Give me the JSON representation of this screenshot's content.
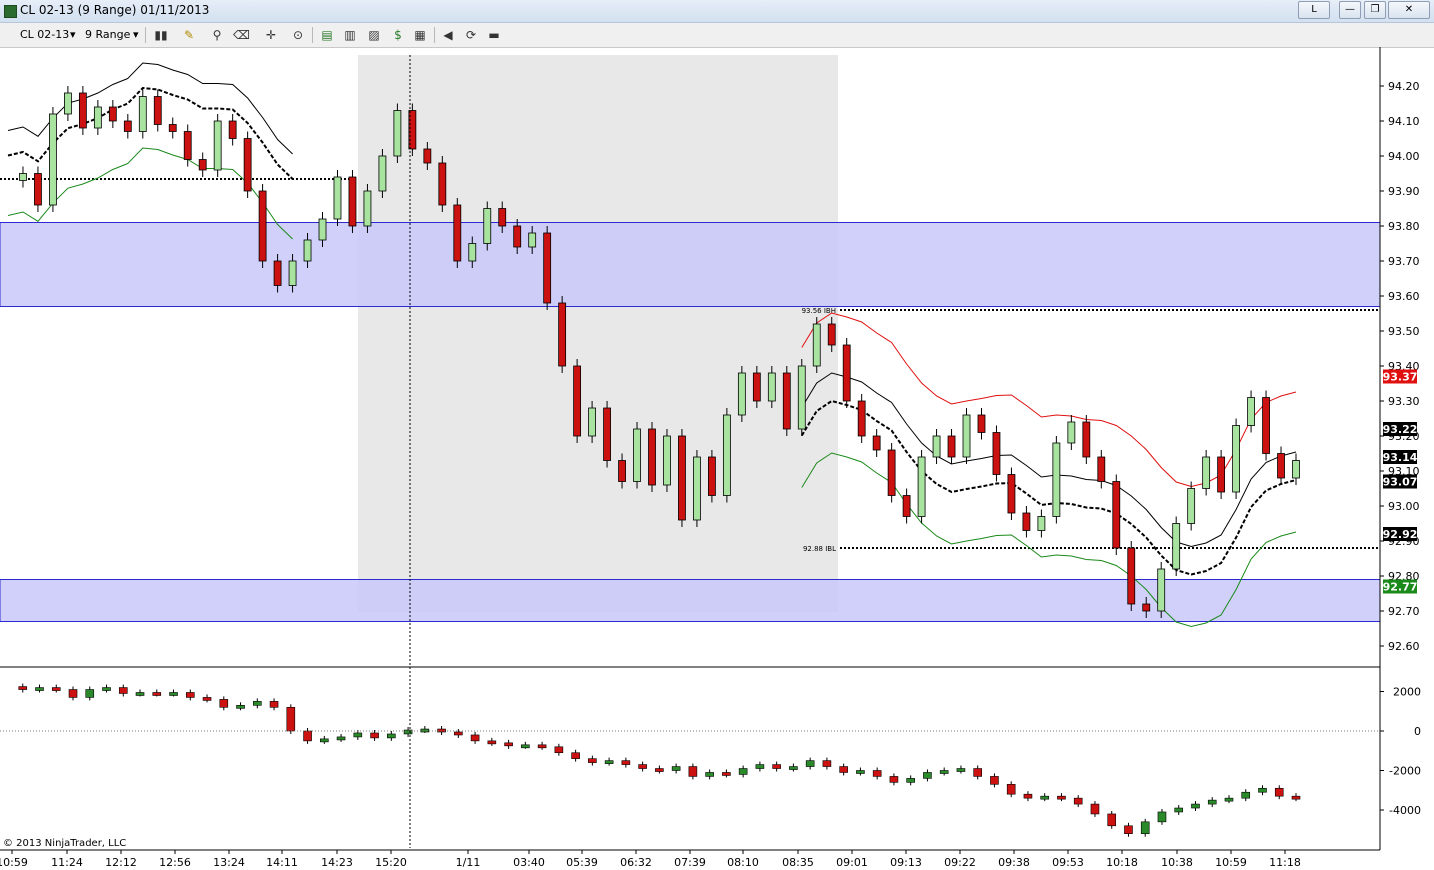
{
  "window": {
    "title": "CL 02-13 (9 Range)  01/11/2013",
    "buttons": {
      "restore": "L",
      "minimize": "—",
      "maximize": "❐",
      "close": "✕"
    }
  },
  "toolbar": {
    "instrument": "CL 02-13",
    "period": "9 Range",
    "icons": [
      "bars-type-icon",
      "draw-pencil-icon",
      "zoom-icon",
      "eraser-icon",
      "crosshair-icon",
      "magnifier-icon",
      "data-box-icon",
      "indicators-icon",
      "strategies-icon",
      "dollar-icon",
      "properties-icon",
      "scroll-back-icon",
      "reload-icon",
      "print-icon"
    ]
  },
  "price_axis": {
    "ticks": [
      "94.20",
      "94.10",
      "94.00",
      "93.90",
      "93.80",
      "93.70",
      "93.60",
      "93.50",
      "93.40",
      "93.30",
      "93.20",
      "93.10",
      "93.00",
      "92.90",
      "92.80",
      "92.70",
      "92.60"
    ],
    "labels": [
      {
        "text": "93.37",
        "color": "#e01010"
      },
      {
        "text": "93.22",
        "color": "#000000"
      },
      {
        "text": "93.14",
        "color": "#000000"
      },
      {
        "text": "93.07",
        "color": "#000000"
      },
      {
        "text": "92.92",
        "color": "#000000"
      },
      {
        "text": "92.77",
        "color": "#1a8a1a"
      }
    ]
  },
  "indicator_axis": {
    "ticks": [
      "2000",
      "0",
      "-2000",
      "-4000"
    ]
  },
  "time_axis": [
    "10:59",
    "11:24",
    "12:12",
    "12:56",
    "13:24",
    "14:11",
    "14:23",
    "15:20",
    "1/11",
    "03:40",
    "05:39",
    "06:32",
    "07:39",
    "08:10",
    "08:35",
    "09:01",
    "09:13",
    "09:22",
    "09:38",
    "09:53",
    "10:18",
    "10:38",
    "10:59",
    "11:18"
  ],
  "annotations": {
    "ib_high": "93.56 IBH",
    "ib_low": "92.88 IBL"
  },
  "copyright": "© 2013 NinjaTrader, LLC",
  "colors": {
    "up": "#a8e4a0",
    "down": "#cc1111",
    "zone": "#c8c8fa",
    "zone_border": "#2a2ad0",
    "session": "#e8e8e8"
  },
  "chart_data": {
    "type": "candlestick",
    "instrument": "CL 02-13",
    "bar_type": "9 Range",
    "ylim": [
      92.57,
      94.29
    ],
    "zones": [
      {
        "low": 93.57,
        "high": 93.81
      },
      {
        "low": 92.67,
        "high": 92.79
      }
    ],
    "levels": [
      {
        "label": "93.56 IBH",
        "value": 93.56
      },
      {
        "label": "92.88 IBL",
        "value": 92.88
      }
    ],
    "price_path": [
      93.93,
      93.95,
      93.86,
      94.12,
      94.18,
      94.08,
      94.14,
      94.1,
      94.07,
      94.17,
      94.09,
      94.07,
      93.99,
      93.96,
      94.1,
      94.05,
      93.9,
      93.7,
      93.63,
      93.7,
      93.76,
      93.82,
      93.94,
      93.8,
      93.9,
      94.0,
      94.13,
      94.02,
      93.98,
      93.86,
      93.7,
      93.75,
      93.85,
      93.8,
      93.74,
      93.78,
      93.58,
      93.4,
      93.2,
      93.28,
      93.13,
      93.07,
      93.22,
      93.06,
      93.2,
      92.96,
      93.14,
      93.03,
      93.26,
      93.38,
      93.3,
      93.38,
      93.22,
      93.4,
      93.52,
      93.46,
      93.3,
      93.2,
      93.16,
      93.03,
      92.97,
      93.14,
      93.2,
      93.14,
      93.26,
      93.21,
      93.09,
      92.98,
      92.93,
      92.97,
      93.18,
      93.24,
      93.14,
      93.07,
      92.88,
      92.72,
      92.7,
      92.82,
      92.95,
      93.05,
      93.14,
      93.04,
      93.23,
      93.31,
      93.15,
      93.08,
      93.13
    ],
    "indicator": {
      "ylim": [
        -5450,
        2800
      ],
      "values": [
        2250,
        2100,
        2200,
        2100,
        1700,
        2100,
        2200,
        1900,
        1950,
        1900,
        1950,
        1700,
        1600,
        1200,
        1300,
        1500,
        1200,
        0,
        -500,
        -400,
        -300,
        -100,
        -350,
        -150,
        50,
        100,
        -50,
        -200,
        -500,
        -600,
        -750,
        -700,
        -800,
        -1100,
        -1400,
        -1600,
        -1500,
        -1700,
        -1900,
        -2000,
        -1800,
        -2300,
        -2100,
        -2200,
        -1900,
        -1700,
        -1900,
        -1800,
        -1500,
        -1800,
        -2100,
        -2000,
        -2300,
        -2600,
        -2400,
        -2100,
        -2000,
        -1900,
        -2300,
        -2700,
        -3200,
        -3400,
        -3300,
        -3400,
        -3700,
        -4200,
        -4800,
        -5200,
        -4600,
        -4100,
        -3900,
        -3700,
        -3500,
        -3400,
        -3100,
        -2900,
        -3300,
        -3400
      ]
    }
  }
}
